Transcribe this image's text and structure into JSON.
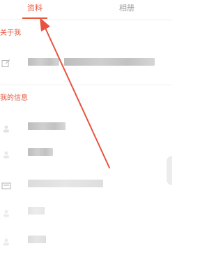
{
  "colors": {
    "accent": "#e8583f",
    "muted": "#9a9a9a",
    "annotation": "#e8533f"
  },
  "tabs": [
    {
      "label": "资料",
      "active": true
    },
    {
      "label": "相册",
      "active": false
    }
  ],
  "sections": {
    "about": {
      "title": "关于我",
      "icon": "edit-icon"
    },
    "info": {
      "title": "我的信息"
    }
  },
  "info_rows": [
    {
      "icon": "person-icon"
    },
    {
      "icon": "person-icon"
    },
    {
      "icon": "card-icon"
    },
    {
      "icon": "person-icon"
    },
    {
      "icon": "person-icon"
    }
  ]
}
